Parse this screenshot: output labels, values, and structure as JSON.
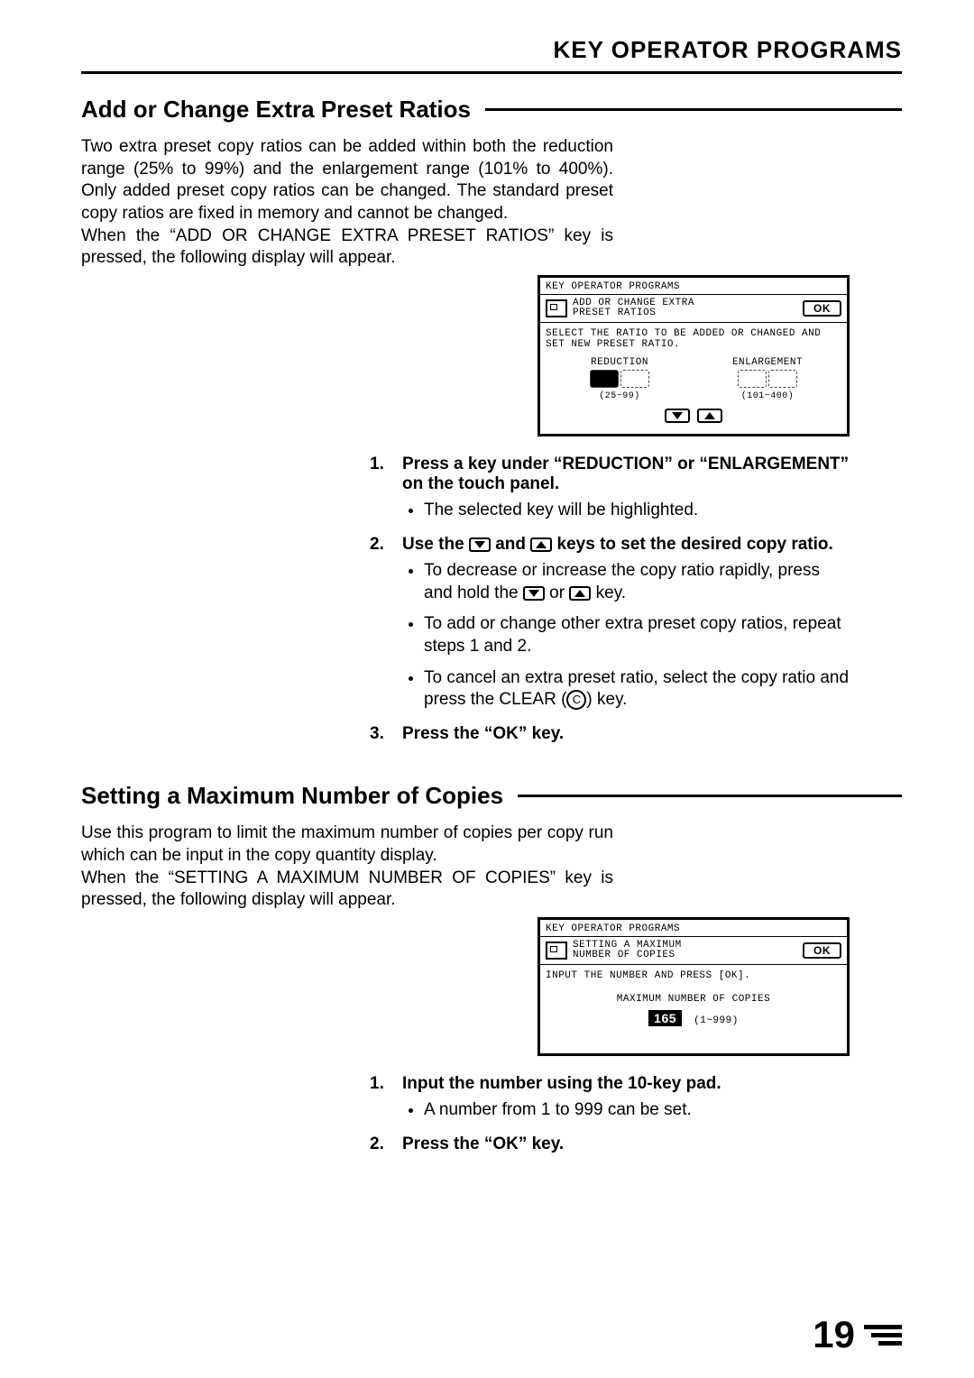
{
  "page_header": "KEY OPERATOR PROGRAMS",
  "page_number": "19",
  "section1": {
    "title": "Add or Change Extra Preset Ratios",
    "intro": "Two extra preset copy ratios can be added within both the reduction range (25% to 99%) and the enlargement range (101% to 400%). Only added preset copy ratios can be changed. The standard preset copy ratios are fixed in memory and cannot be changed.\nWhen the “ADD OR CHANGE EXTRA PRESET RATIOS” key is pressed, the following display will appear.",
    "lcd": {
      "title": "KEY OPERATOR PROGRAMS",
      "subtitle": "ADD OR CHANGE EXTRA\nPRESET RATIOS",
      "ok": "OK",
      "message": "SELECT THE RATIO TO BE ADDED OR CHANGED AND SET NEW PRESET RATIO.",
      "col_left": "REDUCTION",
      "col_right": "ENLARGEMENT",
      "range_left": "(25~99)",
      "range_right": "(101~400)"
    },
    "steps": [
      {
        "num": "1.",
        "head": "Press a key under “REDUCTION” or “ENLARGEMENT” on the touch panel.",
        "bullets": [
          "The selected key will be highlighted."
        ]
      },
      {
        "num": "2.",
        "head_parts": [
          "Use the ",
          " and ",
          " keys to set the desired copy ratio."
        ],
        "bullets_complex": true,
        "b2a_parts": [
          "To decrease or increase the copy ratio rapidly, press and hold the ",
          " or ",
          " key."
        ],
        "b2b": "To add or change other extra preset copy ratios, repeat steps 1 and 2.",
        "b2c_parts": [
          "To cancel an extra preset ratio, select the copy ratio and press the CLEAR (",
          ") key."
        ],
        "clear_char": "C"
      },
      {
        "num": "3.",
        "head": "Press the “OK” key."
      }
    ]
  },
  "section2": {
    "title": "Setting a Maximum Number of Copies",
    "intro": "Use this program to limit the maximum number of copies per copy run which can be input in the copy quantity display.\nWhen the “SETTING A MAXIMUM NUMBER OF COPIES” key is pressed, the following display will appear.",
    "lcd": {
      "title": "KEY OPERATOR PROGRAMS",
      "subtitle": "SETTING A MAXIMUM\nNUMBER OF COPIES",
      "ok": "OK",
      "message": "INPUT THE NUMBER AND PRESS [OK].",
      "label": "MAXIMUM NUMBER OF COPIES",
      "value": "165",
      "range": "(1~999)"
    },
    "steps": [
      {
        "num": "1.",
        "head": "Input the number using the 10-key pad.",
        "bullets": [
          "A number from 1 to 999 can be set."
        ]
      },
      {
        "num": "2.",
        "head": "Press the “OK” key."
      }
    ]
  }
}
